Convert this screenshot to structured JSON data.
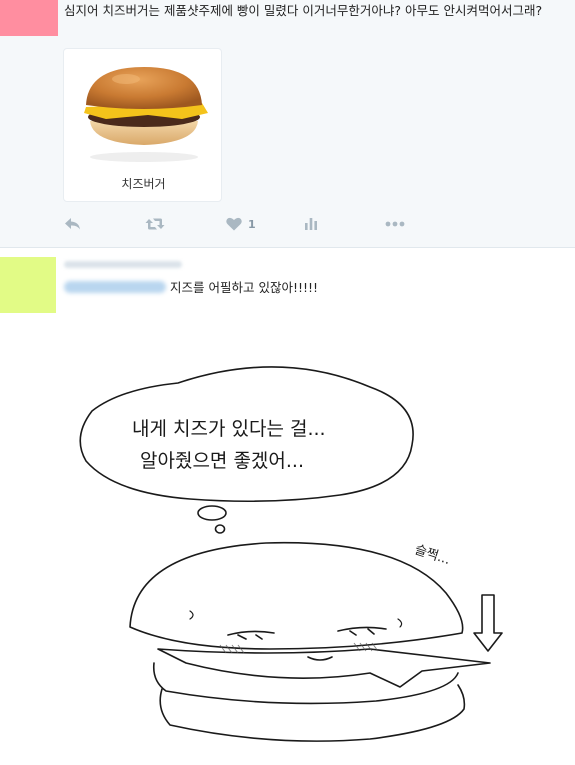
{
  "tweet1": {
    "text": "심지어 치즈버거는 제품샷주제에 빵이 밀렸다 이거너무한거아냐? 아무도 안시켜먹어서그래?",
    "card": {
      "caption": "치즈버거"
    },
    "actions": {
      "like_count": "1"
    }
  },
  "tweet2": {
    "text": "지즈를 어필하고 있잖아!!!!!",
    "comic": {
      "bubble_line1": "내게 치즈가 있다는 걸...",
      "bubble_line2": "알아줬으면 좋겠어...",
      "annotation": "슬쩍..."
    }
  },
  "colors": {
    "avatar1": "#ff8ea0",
    "avatar2": "#e2fb86",
    "action_icon": "#aab8c2",
    "tweet1_background": "#f5f8fa"
  },
  "icons": [
    "reply-icon",
    "retweet-icon",
    "heart-icon",
    "analytics-icon",
    "more-icon"
  ]
}
